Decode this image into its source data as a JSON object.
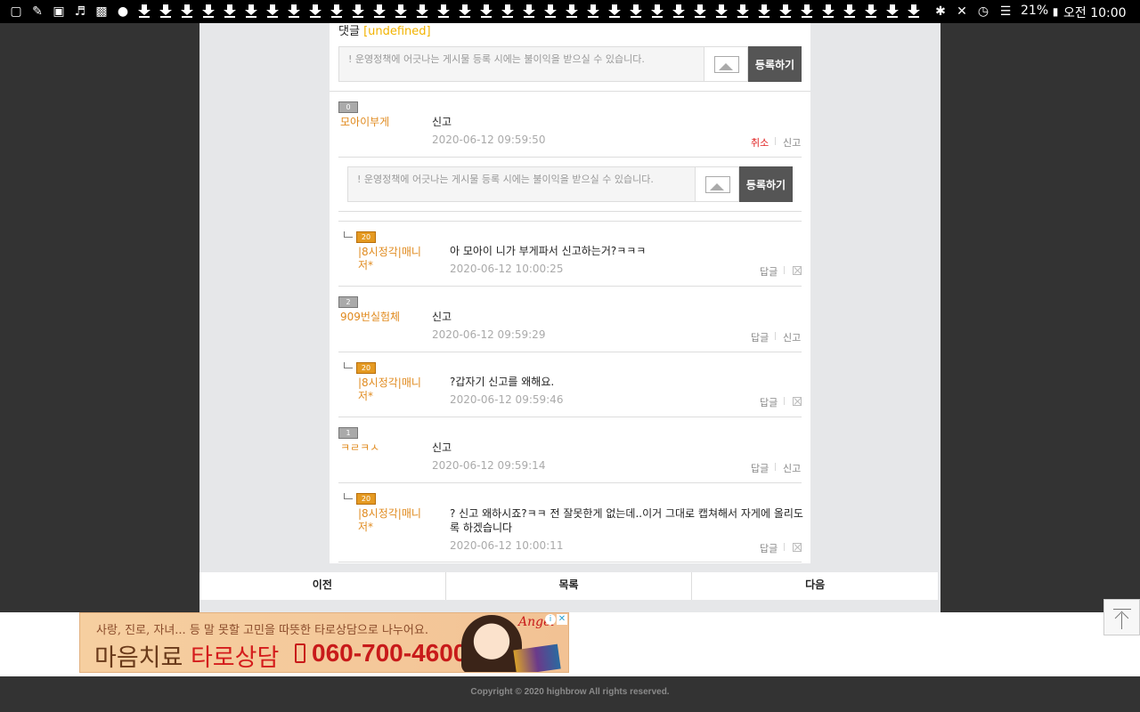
{
  "status_bar": {
    "battery": "21%",
    "time": "오전 10:00"
  },
  "comments_header": {
    "label": "댓글",
    "count_tag": "[undefined]"
  },
  "write_form": {
    "placeholder": "! 운영정책에 어긋나는 게시물 등록 시에는 불이익을 받으실 수 있습니다.",
    "submit_label": "등록하기"
  },
  "comments": [
    {
      "level": "0",
      "nickname": "모아이부게",
      "text": "신고",
      "date": "2020-06-12 09:59:50",
      "actions": [
        "취소",
        "신고"
      ]
    },
    {
      "level": "20",
      "nickname": "|8시정각|매니저*",
      "text": "아 모아이 니가 부게파서 신고하는거?ㅋㅋㅋ",
      "date": "2020-06-12 10:00:25",
      "actions": [
        "답글"
      ]
    },
    {
      "level": "2",
      "nickname": "909번실험체",
      "text": "신고",
      "date": "2020-06-12 09:59:29",
      "actions": [
        "답글",
        "신고"
      ]
    },
    {
      "level": "20",
      "nickname": "|8시정각|매니저*",
      "text": "?갑자기 신고를 왜해요.",
      "date": "2020-06-12 09:59:46",
      "actions": [
        "답글"
      ]
    },
    {
      "level": "1",
      "nickname": "ㅋㄹㅋㅅ",
      "text": "신고",
      "date": "2020-06-12 09:59:14",
      "actions": [
        "답글",
        "신고"
      ]
    },
    {
      "level": "20",
      "nickname": "|8시정각|매니저*",
      "text": "? 신고 왜하시죠?ㅋㅋ 전 잘못한게 없는데..이거 그대로 캡쳐해서 자게에 올리도록 하겠습니다",
      "date": "2020-06-12 10:00:11",
      "actions": [
        "답글"
      ]
    }
  ],
  "nav": {
    "prev": "이전",
    "list": "목록",
    "next": "다음"
  },
  "ad": {
    "line1": "사랑, 진로, 자녀... 등 말 못할 고민을 따뜻한 타로상담으로 나누어요.",
    "line2_a": "마음치료",
    "line2_b": "타로상담",
    "phone": "060-700-4600",
    "brand": "Angel"
  },
  "footer": {
    "copyright": "Copyright © 2020 highbrow All rights reserved."
  }
}
